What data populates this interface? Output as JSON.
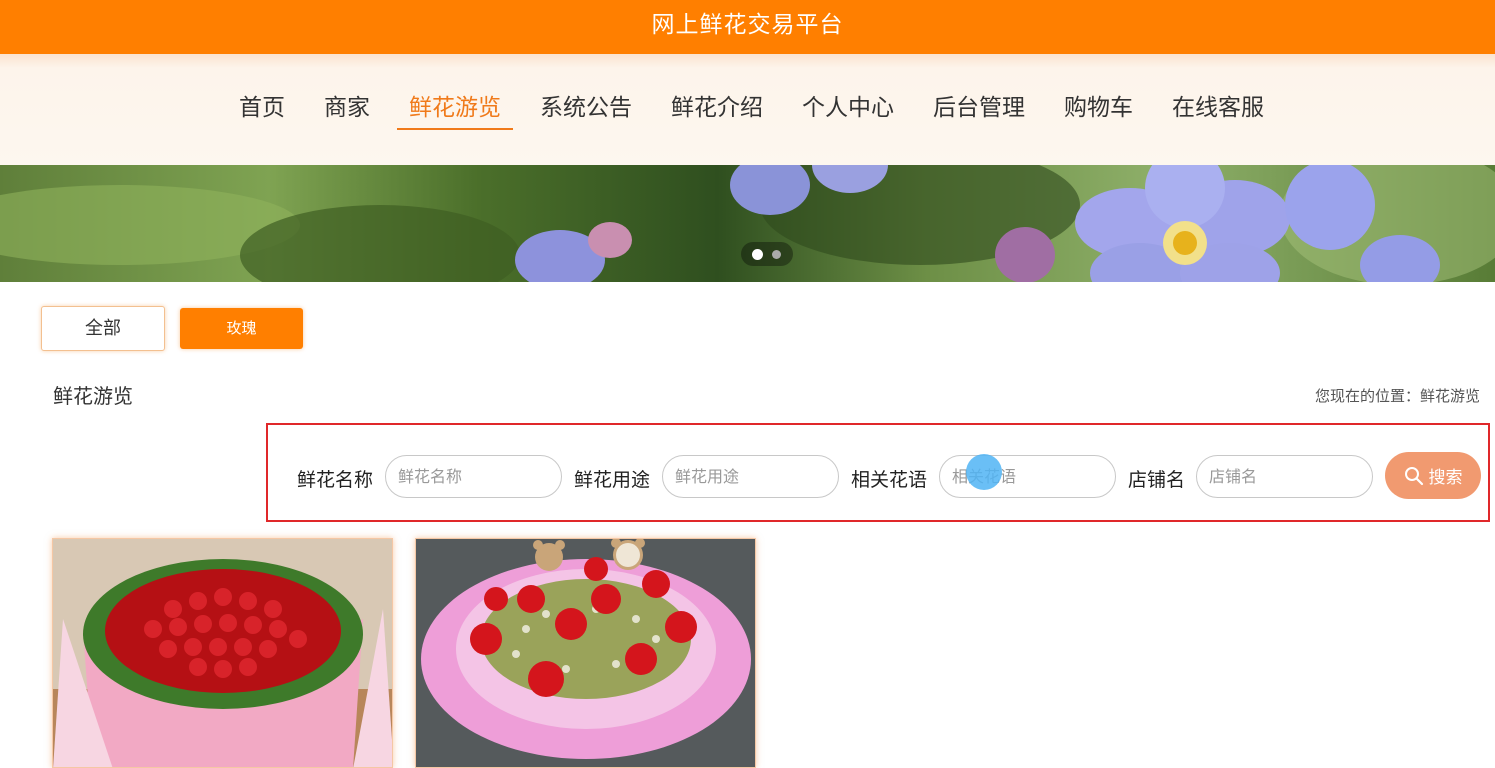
{
  "app_title": "网上鲜花交易平台",
  "nav": {
    "items": [
      {
        "label": "首页"
      },
      {
        "label": "商家"
      },
      {
        "label": "鲜花游览",
        "active": true
      },
      {
        "label": "系统公告"
      },
      {
        "label": "鲜花介绍"
      },
      {
        "label": "个人中心"
      },
      {
        "label": "后台管理"
      },
      {
        "label": "购物车"
      },
      {
        "label": "在线客服"
      }
    ]
  },
  "carousel": {
    "slide_count": 2,
    "active_index": 0
  },
  "categories": [
    {
      "label": "全部",
      "selected": false
    },
    {
      "label": "玫瑰",
      "selected": true
    }
  ],
  "section_title": "鲜花游览",
  "breadcrumb": "您现在的位置：鲜花游览",
  "search": {
    "fields": [
      {
        "label": "鲜花名称",
        "placeholder": "鲜花名称"
      },
      {
        "label": "鲜花用途",
        "placeholder": "鲜花用途"
      },
      {
        "label": "相关花语",
        "placeholder": "相关花语"
      },
      {
        "label": "店铺名",
        "placeholder": "店铺名"
      }
    ],
    "button_label": "搜索"
  },
  "colors": {
    "brand": "#ff7f00",
    "active_nav": "#f07a1a",
    "search_button": "#f19a70",
    "highlight_border": "#e0282a"
  },
  "products": [
    {
      "image": "red-rose-bouquet-pink-wrap"
    },
    {
      "image": "red-rose-bouquet-with-teddy-bears"
    }
  ]
}
